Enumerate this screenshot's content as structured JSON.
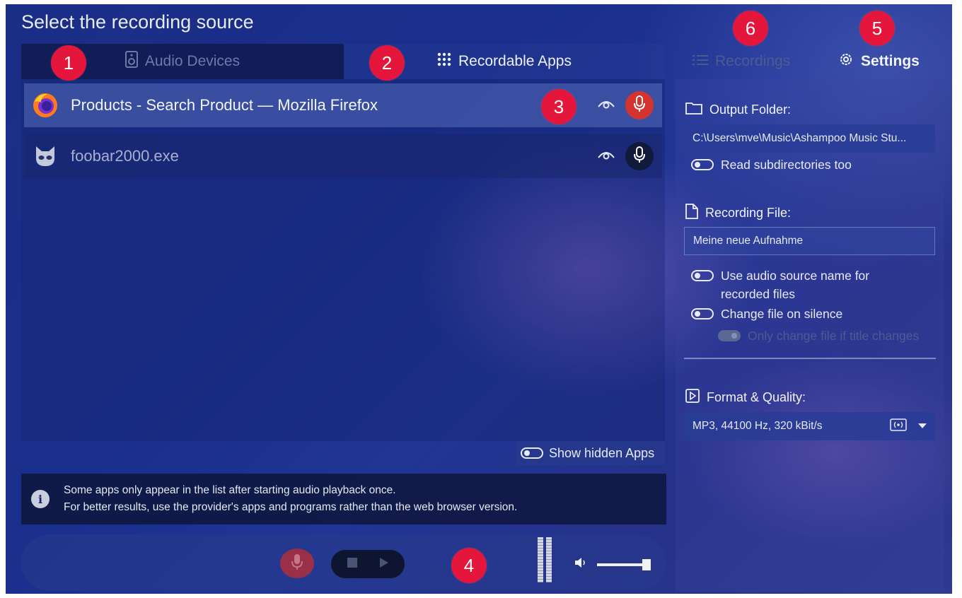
{
  "window": {
    "title": "Select the recording source"
  },
  "tabs": {
    "audio_devices": {
      "label": "Audio Devices",
      "icon": "speaker-icon"
    },
    "recordable_apps": {
      "label": "Recordable Apps",
      "icon": "grid-icon"
    }
  },
  "apps": [
    {
      "name": "Products - Search Product — Mozilla Firefox",
      "icon": "firefox-icon",
      "selected": true,
      "recording": true
    },
    {
      "name": "foobar2000.exe",
      "icon": "foobar-icon",
      "selected": false,
      "recording": false
    }
  ],
  "show_hidden": {
    "label": "Show hidden Apps",
    "enabled": false
  },
  "info": {
    "line1": "Some apps only appear in the list after starting audio playback once.",
    "line2": "For better results, use the provider's apps and programs rather than the web browser version."
  },
  "right_tabs": {
    "recordings": {
      "label": "Recordings",
      "icon": "list-icon"
    },
    "settings": {
      "label": "Settings",
      "icon": "gear-icon"
    }
  },
  "settings": {
    "output_folder": {
      "label": "Output Folder:",
      "value": "C:\\Users\\mve\\Music\\Ashampoo Music Stu...",
      "read_subdirs": {
        "label": "Read subdirectories too",
        "enabled": false
      }
    },
    "recording_file": {
      "label": "Recording File:",
      "value": "Meine neue Aufnahme",
      "use_source_name": {
        "label_line1": "Use audio source name for",
        "label_line2": "recorded files",
        "enabled": false
      },
      "change_on_silence": {
        "label": "Change file on silence",
        "enabled": false
      },
      "only_title_change": {
        "label": "Only change file if title changes",
        "enabled": true,
        "disabled": true
      }
    },
    "format": {
      "label": "Format & Quality:",
      "value": "MP3, 44100 Hz, 320 kBit/s"
    }
  },
  "transport": {
    "volume": 1.0
  },
  "badges": [
    "1",
    "2",
    "3",
    "4",
    "5",
    "6"
  ],
  "colors": {
    "badge": "#e4163c",
    "record_active": "#d43330",
    "background": "#1a2f8c"
  }
}
